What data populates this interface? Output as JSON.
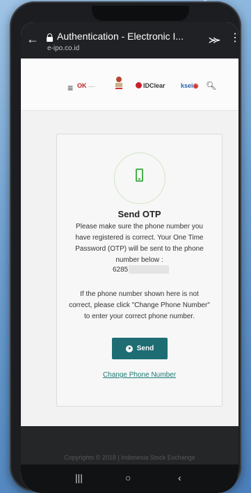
{
  "browser": {
    "title": "Authentication - Electronic I...",
    "url": "e-ipo.co.id"
  },
  "site": {
    "logos": [
      "OJK",
      "Bank Indonesia",
      "IDClear",
      "KSEI"
    ]
  },
  "otp": {
    "heading": "Send OTP",
    "instruction_lines": [
      "Please make sure the phone number you",
      "have registered is correct. Your One Time",
      "Password (OTP) will be sent to the phone",
      "number below :"
    ],
    "phone_prefix": "6285",
    "note_lines": [
      "If the phone number shown here is not",
      "correct, please click \"Change Phone Number\"",
      "to enter your correct phone number."
    ],
    "send_label": "Send",
    "change_label": "Change Phone Number"
  },
  "footer": {
    "copyright": "Copyrights © 2018 | Indonesia Stock Exchange"
  },
  "colors": {
    "primary_button": "#1e6d73",
    "phone_icon": "#48b04b",
    "link": "#1e7a72"
  }
}
